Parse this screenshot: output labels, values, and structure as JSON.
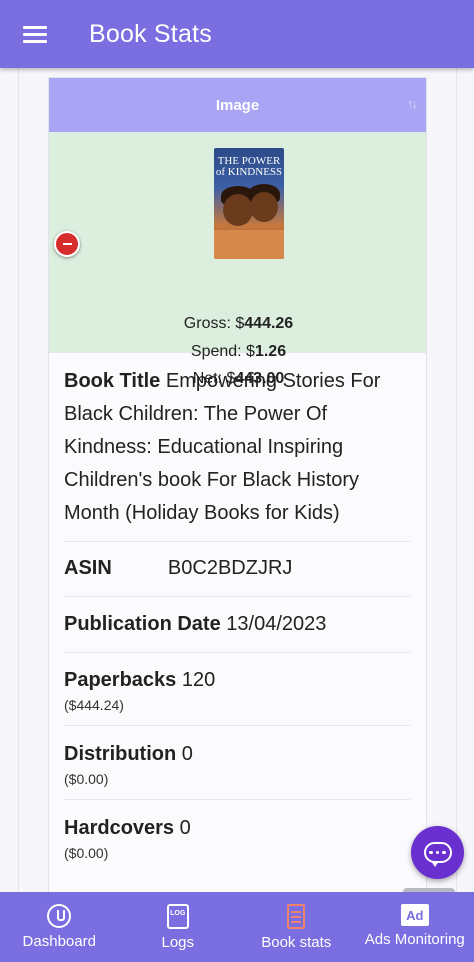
{
  "app_bar": {
    "title": "Book Stats"
  },
  "table": {
    "column_header": "Image",
    "sort_glyph": "↑↓"
  },
  "cover": {
    "title_text": "THE POWER of KINDNESS"
  },
  "stats": {
    "gross_label": "Gross: $",
    "gross_value": "444.26",
    "spend_label": "Spend: $",
    "spend_value": "1.26",
    "net_label": "Net: $",
    "net_value": "443.00"
  },
  "details": {
    "book_title_label": "Book Title",
    "book_title_value": "Empowering Stories For Black Children: The Power Of Kindness: Educational Inspiring Children's book For Black History Month (Holiday Books for Kids)",
    "asin_label": "ASIN",
    "asin_value": "B0C2BDZJRJ",
    "pub_date_label": "Publication Date",
    "pub_date_value": "13/04/2023",
    "paperbacks_label": "Paperbacks",
    "paperbacks_value": "120",
    "paperbacks_amount": "($444.24)",
    "distribution_label": "Distribution",
    "distribution_value": "0",
    "distribution_amount": "($0.00)",
    "hardcovers_label": "Hardcovers",
    "hardcovers_value": "0",
    "hardcovers_amount": "($0.00)"
  },
  "bottom_nav": {
    "items": [
      {
        "label": "Dashboard",
        "icon": "dashboard-icon"
      },
      {
        "label": "Logs",
        "icon": "logs-icon",
        "icon_text": "LOG"
      },
      {
        "label": "Book stats",
        "icon": "book-icon",
        "active": true
      },
      {
        "label": "Ads Monitoring",
        "icon": "ad-icon",
        "icon_text": "Ad"
      }
    ]
  },
  "colors": {
    "primary": "#7b6ee0",
    "header": "#a9a5f4",
    "image_row": "#dcefdf",
    "fab": "#6a2fcf",
    "remove": "#d62c2c",
    "active_icon": "#f08070"
  }
}
